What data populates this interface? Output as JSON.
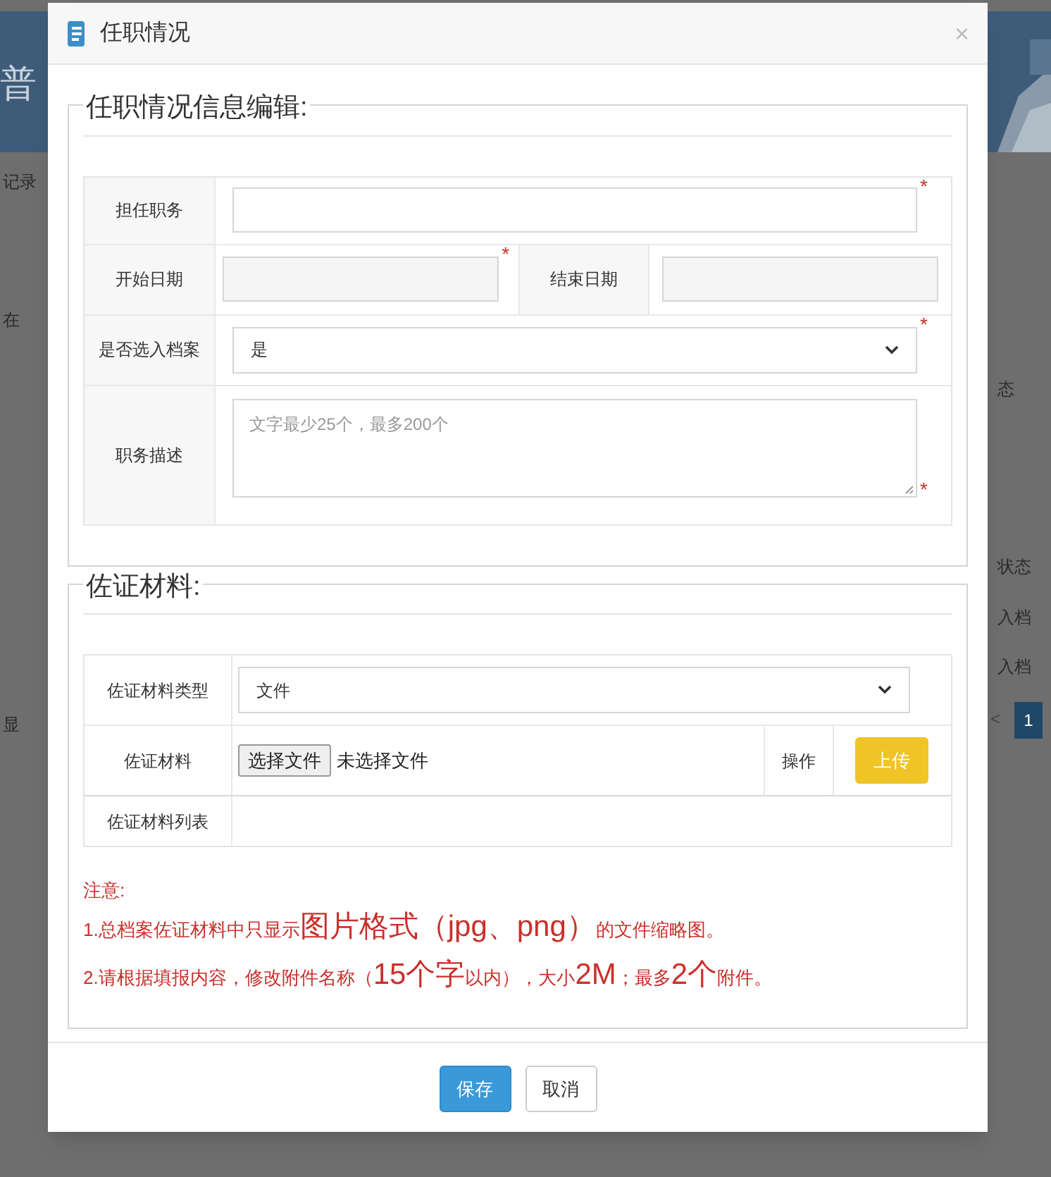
{
  "background": {
    "banner_text": "普",
    "left_texts": [
      "记录",
      "在",
      "显"
    ],
    "right_texts": [
      "态",
      "状态",
      "入档",
      "入档"
    ],
    "page_number": "1",
    "page_prev": "<"
  },
  "dialog": {
    "title": "任职情况",
    "close": "×",
    "info_section": {
      "legend": "任职情况信息编辑:",
      "position": {
        "label": "担任职务",
        "required_mark": "*"
      },
      "start_date": {
        "label": "开始日期",
        "required_mark": "*"
      },
      "end_date": {
        "label": "结束日期"
      },
      "archive": {
        "label": "是否选入档案",
        "value": "是",
        "required_mark": "*"
      },
      "description": {
        "label": "职务描述",
        "placeholder": "文字最少25个，最多200个",
        "required_mark": "*"
      }
    },
    "evidence_section": {
      "legend": "佐证材料:",
      "type": {
        "label": "佐证材料类型",
        "value": "文件"
      },
      "file": {
        "label": "佐证材料",
        "button": "选择文件",
        "status": "未选择文件",
        "action_label": "操作",
        "upload": "上传"
      },
      "list": {
        "label": "佐证材料列表"
      },
      "notes_title": "注意:",
      "notes": [
        [
          {
            "text": "1.总档案佐证材料中只显示",
            "large": false
          },
          {
            "text": "图片格式（jpg、png）",
            "large": true
          },
          {
            "text": "的文件缩略图。",
            "large": false
          }
        ],
        [
          {
            "text": "2.请根据填报内容，修改附件名称（",
            "large": false
          },
          {
            "text": "15个字",
            "large": true
          },
          {
            "text": "以内），大小",
            "large": false
          },
          {
            "text": "2M",
            "large": true
          },
          {
            "text": "；最多",
            "large": false
          },
          {
            "text": "2个",
            "large": true
          },
          {
            "text": "附件。",
            "large": false
          }
        ]
      ]
    },
    "buttons": [
      {
        "label": "保存",
        "kind": "primary"
      },
      {
        "label": "取消",
        "kind": "default"
      }
    ]
  }
}
